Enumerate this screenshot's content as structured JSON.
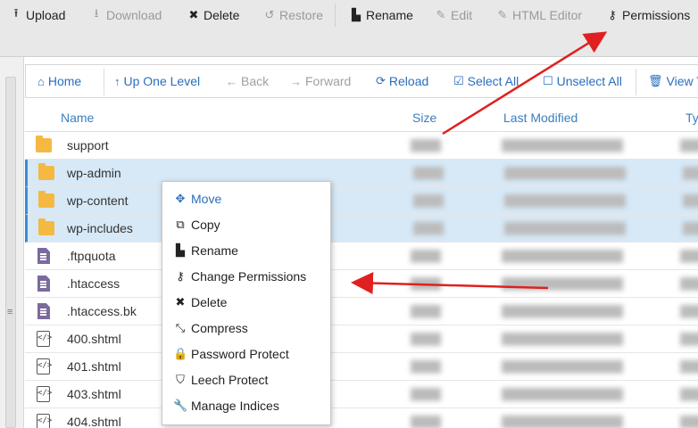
{
  "toolbar": {
    "upload": "Upload",
    "download": "Download",
    "delete": "Delete",
    "restore": "Restore",
    "rename": "Rename",
    "edit": "Edit",
    "html_editor": "HTML Editor",
    "permissions": "Permissions"
  },
  "nav": {
    "home": "Home",
    "up_one_level": "Up One Level",
    "back": "Back",
    "forward": "Forward",
    "reload": "Reload",
    "select_all": "Select All",
    "unselect_all": "Unselect All",
    "view_trash": "View T"
  },
  "table": {
    "columns": [
      "Name",
      "Size",
      "Last Modified",
      "Ty"
    ],
    "rows": [
      {
        "name": "support",
        "type": "folder",
        "selected": false
      },
      {
        "name": "wp-admin",
        "type": "folder",
        "selected": true
      },
      {
        "name": "wp-content",
        "type": "folder",
        "selected": true
      },
      {
        "name": "wp-includes",
        "type": "folder",
        "selected": true
      },
      {
        "name": ".ftpquota",
        "type": "doc",
        "selected": false
      },
      {
        "name": ".htaccess",
        "type": "doc",
        "selected": false
      },
      {
        "name": ".htaccess.bk",
        "type": "doc",
        "selected": false
      },
      {
        "name": "400.shtml",
        "type": "code",
        "selected": false
      },
      {
        "name": "401.shtml",
        "type": "code",
        "selected": false
      },
      {
        "name": "403.shtml",
        "type": "code",
        "selected": false
      },
      {
        "name": "404.shtml",
        "type": "code",
        "selected": false
      }
    ]
  },
  "context_menu": {
    "move": "Move",
    "copy": "Copy",
    "rename": "Rename",
    "change_permissions": "Change Permissions",
    "delete": "Delete",
    "compress": "Compress",
    "password_protect": "Password Protect",
    "leech_protect": "Leech Protect",
    "manage_indices": "Manage Indices"
  },
  "colors": {
    "accent": "#2a6ebb",
    "folder": "#f5b942",
    "selected_row": "#d7e9f7",
    "arrow": "#e02020"
  }
}
